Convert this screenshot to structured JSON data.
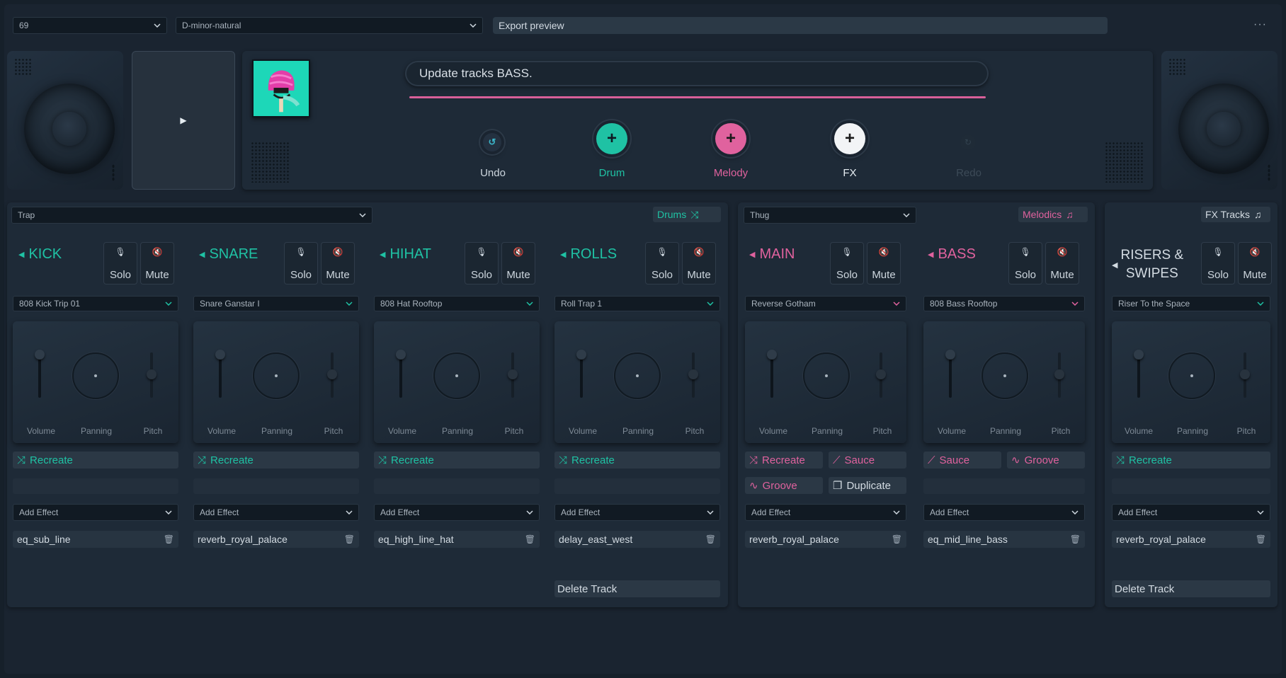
{
  "top": {
    "bpm": "69",
    "scale": "D-minor-natural",
    "export_label": "Export preview",
    "more": "···"
  },
  "prompt": {
    "text": "Update tracks BASS."
  },
  "actions": [
    {
      "label": "Undo",
      "icon": "undo-icon"
    },
    {
      "label": "Drum",
      "icon": "plus-icon",
      "color": "#1fc2a4"
    },
    {
      "label": "Melody",
      "icon": "plus-icon",
      "color": "#e0629e"
    },
    {
      "label": "FX",
      "icon": "plus-icon",
      "color": "#ffffff"
    },
    {
      "label": "Redo",
      "icon": "redo-icon"
    }
  ],
  "mixer_labels": {
    "volume": "Volume",
    "panning": "Panning",
    "pitch": "Pitch"
  },
  "common": {
    "solo": "Solo",
    "mute": "Mute",
    "add_effect": "Add Effect",
    "delete_track": "Delete Track"
  },
  "drums": {
    "genre": "Trap",
    "tag": "Drums",
    "color": "#1fc2a4",
    "tracks": [
      {
        "name": "KICK",
        "sample": "808 Kick Trip 01",
        "buttons": [
          "Recreate"
        ],
        "effect": "eq_sub_line"
      },
      {
        "name": "SNARE",
        "sample": "Snare Ganstar I",
        "buttons": [
          "Recreate"
        ],
        "effect": "reverb_royal_palace"
      },
      {
        "name": "HIHAT",
        "sample": "808 Hat Rooftop",
        "buttons": [
          "Recreate"
        ],
        "effect": "eq_high_line_hat"
      },
      {
        "name": "ROLLS",
        "sample": "Roll Trap 1",
        "buttons": [
          "Recreate"
        ],
        "effect": "delay_east_west"
      }
    ]
  },
  "melodics": {
    "genre": "Thug",
    "tag": "Melodics",
    "color": "#e0629e",
    "tracks": [
      {
        "name": "MAIN",
        "sample": "Reverse Gotham",
        "buttons": [
          "Recreate",
          "Sauce",
          "Groove",
          "Duplicate"
        ],
        "effect": "reverb_royal_palace"
      },
      {
        "name": "BASS",
        "sample": "808 Bass Rooftop",
        "buttons": [
          "Sauce",
          "Groove"
        ],
        "effect": "eq_mid_line_bass"
      }
    ]
  },
  "fxtracks": {
    "tag": "FX Tracks",
    "tracks": [
      {
        "name_line1": "RISERS &",
        "name_line2": "SWIPES",
        "sample": "Riser To the Space",
        "buttons": [
          "Recreate"
        ],
        "effect": "reverb_royal_palace"
      }
    ]
  }
}
